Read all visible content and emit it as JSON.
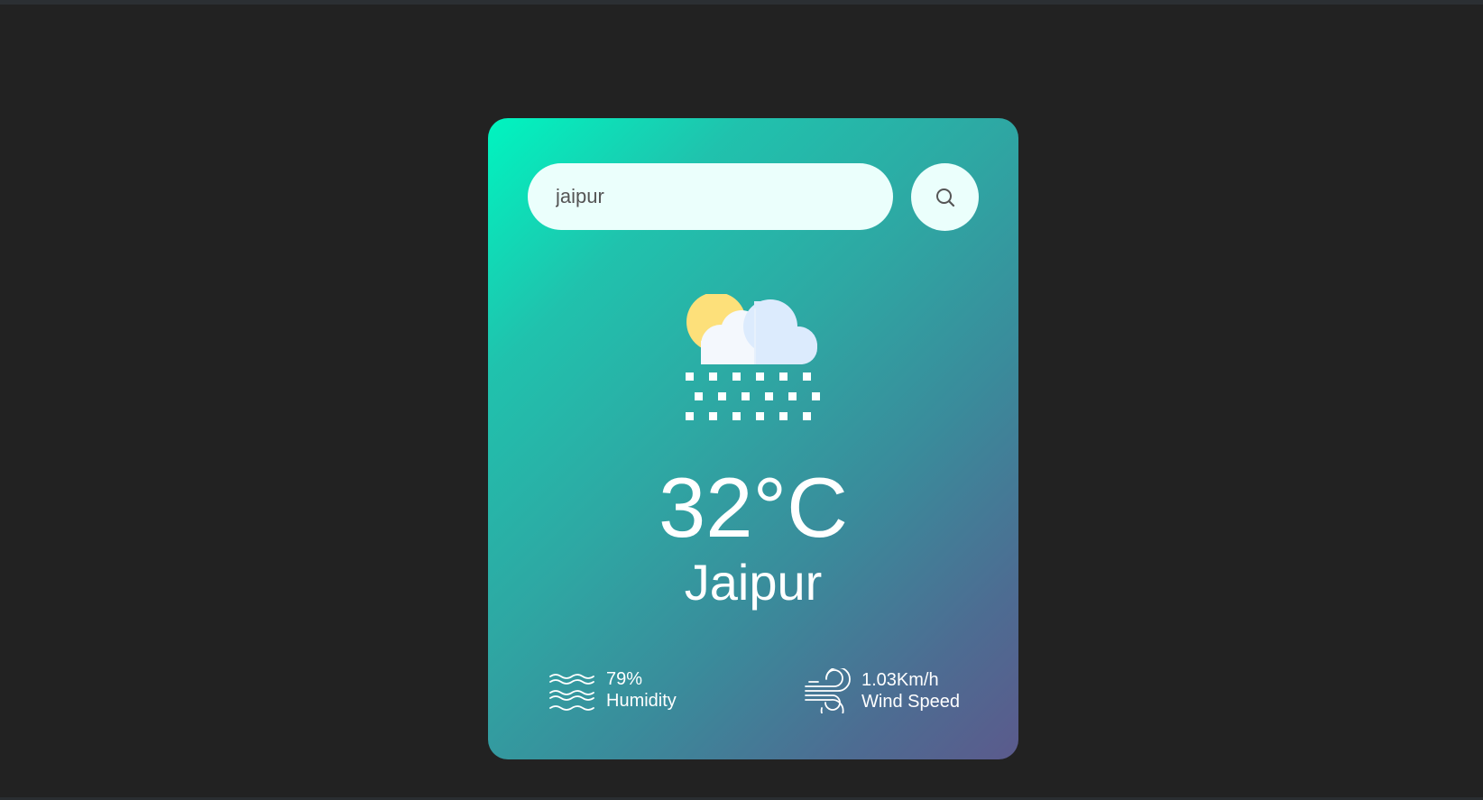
{
  "search": {
    "value": "jaipur",
    "icon": "search-icon"
  },
  "weather": {
    "icon": "sun-cloud-rain-icon",
    "temperature": "32°C",
    "city": "Jaipur"
  },
  "humidity": {
    "icon": "humidity-waves-icon",
    "value": "79%",
    "label": "Humidity"
  },
  "wind": {
    "icon": "wind-icon",
    "value": "1.03Km/h",
    "label": "Wind Speed"
  },
  "colors": {
    "page_background": "#222222",
    "card_gradient_start": "#00f5c0",
    "card_gradient_end": "#5b5a8c",
    "input_background": "#ebfffc",
    "text": "#ffffff"
  }
}
